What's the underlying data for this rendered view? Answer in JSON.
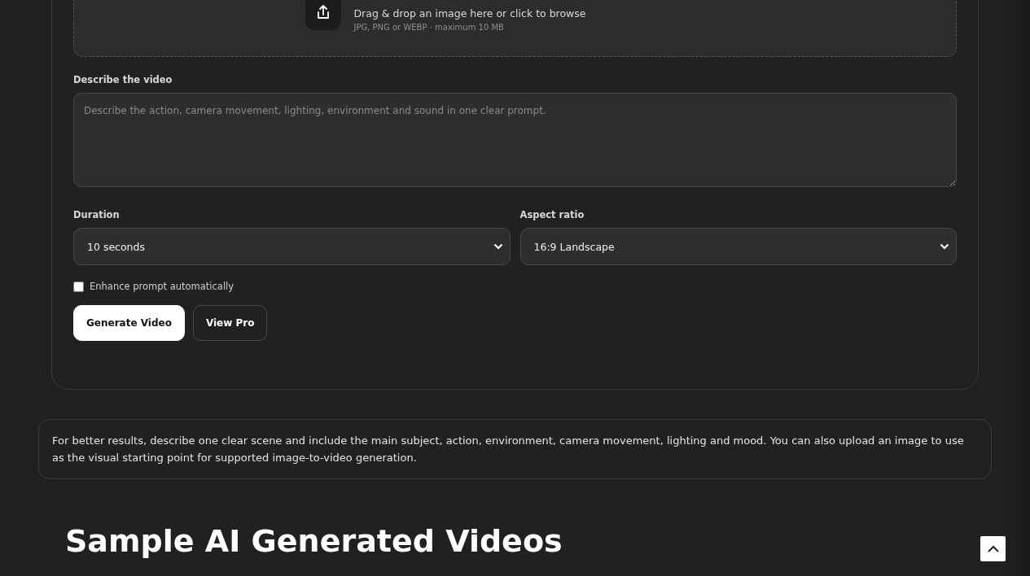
{
  "upload": {
    "hint": "Drag & drop an image here or click to browse",
    "formats": "JPG, PNG or WEBP · maximum 10 MB"
  },
  "prompt": {
    "label": "Describe the video",
    "placeholder": "Describe the action, camera movement, lighting, environment and sound in one clear prompt."
  },
  "selects": [
    {
      "label": "Duration",
      "value": "10 seconds"
    },
    {
      "label": "Aspect ratio",
      "value": "16:9 Landscape"
    }
  ],
  "enhance": {
    "label": "Enhance prompt automatically",
    "checked": false
  },
  "buttons": [
    {
      "label": "Generate Video",
      "kind": "primary"
    },
    {
      "label": "View Pro",
      "kind": "secondary"
    }
  ],
  "tip": "For better results, describe one clear scene and include the main subject, action, environment, camera movement, lighting and mood. You can also upload an image to use as the visual starting point for supported image-to-video generation.",
  "section_heading": "Sample AI Generated Videos"
}
